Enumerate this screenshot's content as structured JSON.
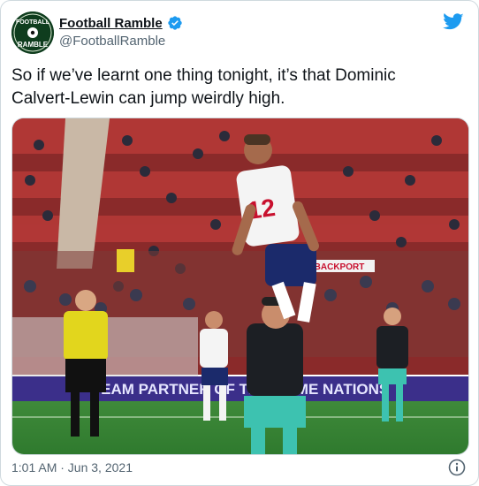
{
  "author": {
    "display_name": "Football Ramble",
    "handle": "@FootballRamble",
    "avatar_text_top": "FOOTBALL",
    "avatar_text_bottom": "RAMBLE",
    "verified": true
  },
  "tweet": {
    "text": "So if we’ve learnt one thing tonight, it’s that Dominic Calvert-Lewin can jump weirdly high.",
    "timestamp": "1:01 AM · Jun 3, 2021"
  },
  "media": {
    "player_number": "12",
    "banner_text": "TEAM PARTNER OF THE HOME NATIONS",
    "board_text": "BACKPORT"
  },
  "colors": {
    "twitter_blue": "#1d9bf0",
    "text": "#0f1419",
    "secondary": "#536471",
    "border": "#cfd9de"
  },
  "icons": [
    "twitter-bird-icon",
    "verified-badge-icon",
    "info-icon"
  ]
}
